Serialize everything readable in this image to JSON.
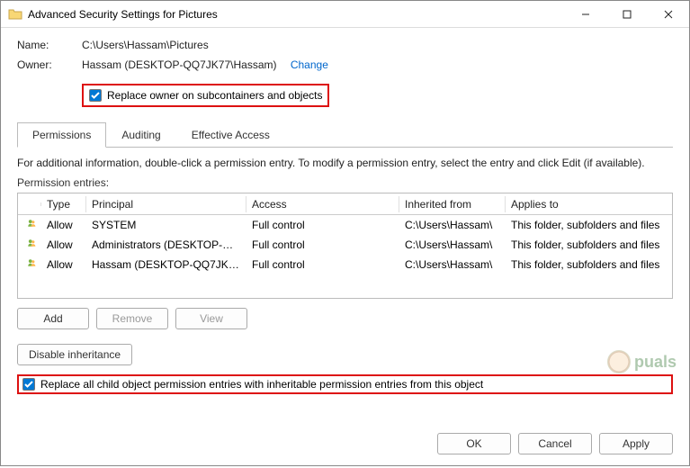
{
  "titlebar": {
    "title": "Advanced Security Settings for Pictures"
  },
  "fields": {
    "name_label": "Name:",
    "name_value": "C:\\Users\\Hassam\\Pictures",
    "owner_label": "Owner:",
    "owner_value": "Hassam (DESKTOP-QQ7JK77\\Hassam)",
    "change_link": "Change",
    "replace_owner_label": "Replace owner on subcontainers and objects"
  },
  "tabs": {
    "permissions": "Permissions",
    "auditing": "Auditing",
    "effective": "Effective Access"
  },
  "info": "For additional information, double-click a permission entry. To modify a permission entry, select the entry and click Edit (if available).",
  "entries_label": "Permission entries:",
  "columns": {
    "type": "Type",
    "principal": "Principal",
    "access": "Access",
    "inherited": "Inherited from",
    "applies": "Applies to"
  },
  "rows": [
    {
      "type": "Allow",
      "principal": "SYSTEM",
      "access": "Full control",
      "inherited": "C:\\Users\\Hassam\\",
      "applies": "This folder, subfolders and files"
    },
    {
      "type": "Allow",
      "principal": "Administrators (DESKTOP-QQ...",
      "access": "Full control",
      "inherited": "C:\\Users\\Hassam\\",
      "applies": "This folder, subfolders and files"
    },
    {
      "type": "Allow",
      "principal": "Hassam (DESKTOP-QQ7JK77\\...",
      "access": "Full control",
      "inherited": "C:\\Users\\Hassam\\",
      "applies": "This folder, subfolders and files"
    }
  ],
  "buttons": {
    "add": "Add",
    "remove": "Remove",
    "view": "View",
    "disable_inh": "Disable inheritance",
    "ok": "OK",
    "cancel": "Cancel",
    "apply": "Apply"
  },
  "replace_child_label": "Replace all child object permission entries with inheritable permission entries from this object",
  "watermark": "puals"
}
